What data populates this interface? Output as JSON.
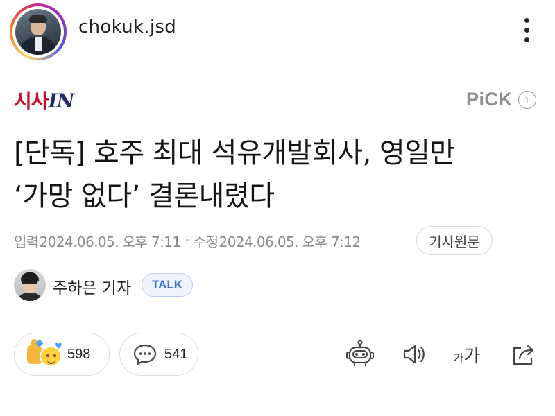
{
  "header": {
    "username": "chokuk.jsd"
  },
  "publisher": {
    "logo_part1": "시사",
    "logo_part2": "IN",
    "pick_label": "PiCK",
    "info_label": "i"
  },
  "article": {
    "headline_line1": "[단독] 호주 최대 석유개발회사, 영일만",
    "headline_line2": "‘가망 없다’ 결론내렸다",
    "published_label": "입력",
    "published_time": "2024.06.05. 오후 7:11",
    "edited_label": "수정",
    "edited_time": "2024.06.05. 오후 7:12",
    "original_button": "기사원문"
  },
  "reporter": {
    "name": "주하은 기자",
    "talk_label": "TALK"
  },
  "actions": {
    "like_count": "598",
    "comment_count": "541",
    "font_small": "가",
    "font_large": "가"
  },
  "colors": {
    "logo_red": "#c8102e",
    "logo_navy": "#1f2d6b",
    "talk_blue": "#3d6bd8",
    "meta_gray": "#8a8a8a"
  }
}
